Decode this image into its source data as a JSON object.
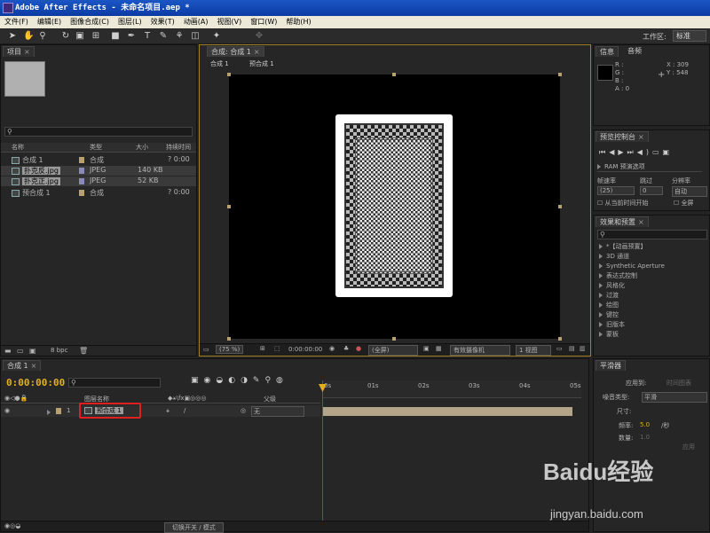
{
  "window": {
    "title": "Adobe After Effects - 未命名项目.aep *"
  },
  "menu": [
    "文件(F)",
    "编辑(E)",
    "图像合成(C)",
    "图层(L)",
    "效果(T)",
    "动画(A)",
    "视图(V)",
    "窗口(W)",
    "帮助(H)"
  ],
  "toolbar": {
    "workspace_label": "工作区:",
    "workspace_value": "标准"
  },
  "project": {
    "tab": "项目",
    "search_icon": "search-icon",
    "columns": [
      "名称",
      "类型",
      "大小",
      "持续时间"
    ],
    "items": [
      {
        "name": "合成 1",
        "type": "合成",
        "size": "",
        "duration": "? 0:00",
        "color": "#b8a070"
      },
      {
        "name": "扑克反.jpg",
        "type": "JPEG",
        "size": "140 KB",
        "duration": "",
        "color": "#8a8ab8"
      },
      {
        "name": "扑克正.jpg",
        "type": "JPEG",
        "size": "52 KB",
        "duration": "",
        "color": "#8a8ab8"
      },
      {
        "name": "预合成 1",
        "type": "合成",
        "size": "",
        "duration": "? 0:00",
        "color": "#b8a070"
      }
    ],
    "bpc": "8 bpc"
  },
  "composition": {
    "tab": "合成: 合成 1",
    "subtabs": [
      "合成 1",
      "预合成 1"
    ],
    "zoom": "(75 %)",
    "timecode": "0:00:00:00",
    "resolution": "(全屏)",
    "camera": "有效摄像机",
    "views": "1 视图"
  },
  "info": {
    "tabs": [
      "信息",
      "音频"
    ],
    "r": "R :",
    "g": "G :",
    "b": "B :",
    "a": "A : 0",
    "x": "X : 309",
    "y": "Y : 548"
  },
  "preview": {
    "tab": "预览控制台",
    "ram": "RAM 预演选项",
    "fps_label": "帧速率",
    "skip_label": "跳过",
    "res_label": "分辨率",
    "fps_value": "(25)",
    "skip_value": "0",
    "res_value": "自动",
    "from_current": "从当前时间开始",
    "fullscreen": "全屏"
  },
  "effects": {
    "tab": "效果和预置",
    "items": [
      "*【动画预置】",
      "3D 通道",
      "Synthetic Aperture",
      "表达式控制",
      "风格化",
      "过渡",
      "绘图",
      "键控",
      "旧版本",
      "蒙板"
    ]
  },
  "timeline": {
    "tab": "合成 1",
    "timecode": "0:00:00:00",
    "columns": [
      "图层名称",
      "父级"
    ],
    "ruler": [
      "0s",
      "01s",
      "02s",
      "03s",
      "04s",
      "05s"
    ],
    "layer": {
      "index": "1",
      "name": "预合成 1",
      "parent": "无"
    },
    "footer": "切换开关 / 模式"
  },
  "smoother": {
    "tab": "平滑器",
    "apply_label": "应用到:",
    "apply_value": "时间图表",
    "noise_label": "噪音类型:",
    "noise_value": "平滑",
    "size_label": "尺寸:",
    "freq_label": "频率:",
    "freq_value": "5.0",
    "freq_unit": "/秒",
    "amount_label": "数量:",
    "amount_value": "1.0",
    "apply_button": "应用"
  },
  "watermark": {
    "brand": "Baidu经验",
    "url": "jingyan.baidu.com"
  }
}
